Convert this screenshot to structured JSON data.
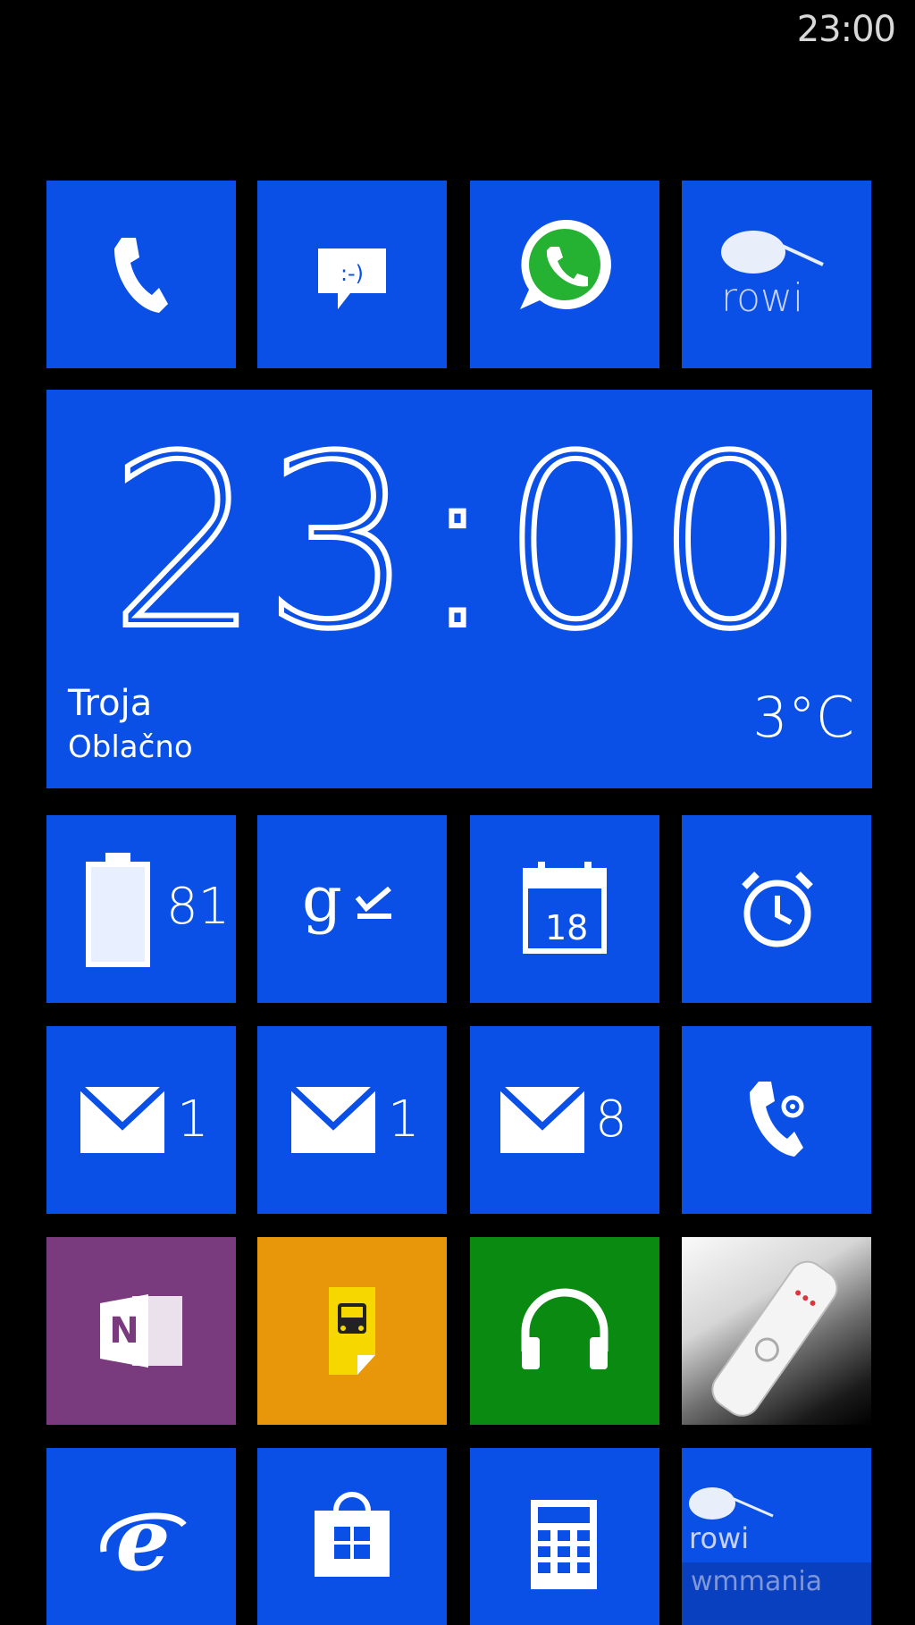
{
  "status_bar": {
    "time": "23:00"
  },
  "tiles": {
    "phone": {
      "icon": "phone-icon"
    },
    "messaging": {
      "icon": "message-icon"
    },
    "whatsapp": {
      "icon": "whatsapp-icon"
    },
    "rowi": {
      "label": "rowi",
      "icon": "kiwi-bird-icon"
    },
    "weather_clock": {
      "time": "23:00",
      "city": "Troja",
      "condition": "Oblačno",
      "temperature": "3°C"
    },
    "battery": {
      "value": "81",
      "icon": "battery-icon"
    },
    "google_tasks": {
      "icon": "google-tasks-icon"
    },
    "calendar": {
      "day": "18",
      "icon": "calendar-icon"
    },
    "alarms": {
      "icon": "alarm-clock-icon"
    },
    "mail_1": {
      "count": "1",
      "icon": "mail-icon"
    },
    "mail_2": {
      "count": "1",
      "icon": "mail-icon"
    },
    "mail_3": {
      "count": "8",
      "icon": "mail-icon"
    },
    "call_settings": {
      "icon": "phone-gear-icon"
    },
    "onenote": {
      "icon": "onenote-icon"
    },
    "transit": {
      "icon": "bus-note-icon"
    },
    "music": {
      "icon": "headphones-icon"
    },
    "flashlight": {
      "icon": "flashlight-icon"
    },
    "internet_explorer": {
      "icon": "ie-icon"
    },
    "store": {
      "icon": "store-bag-icon"
    },
    "calculator": {
      "icon": "calculator-icon"
    },
    "rowi_small": {
      "label": "rowi",
      "sublabel": "wmmania",
      "icon": "kiwi-bird-icon"
    }
  },
  "colors": {
    "accent": "#0a50e6",
    "onenote": "#7a3a7e",
    "transit": "#e8960a",
    "music": "#0b8a12",
    "background": "#000000"
  }
}
